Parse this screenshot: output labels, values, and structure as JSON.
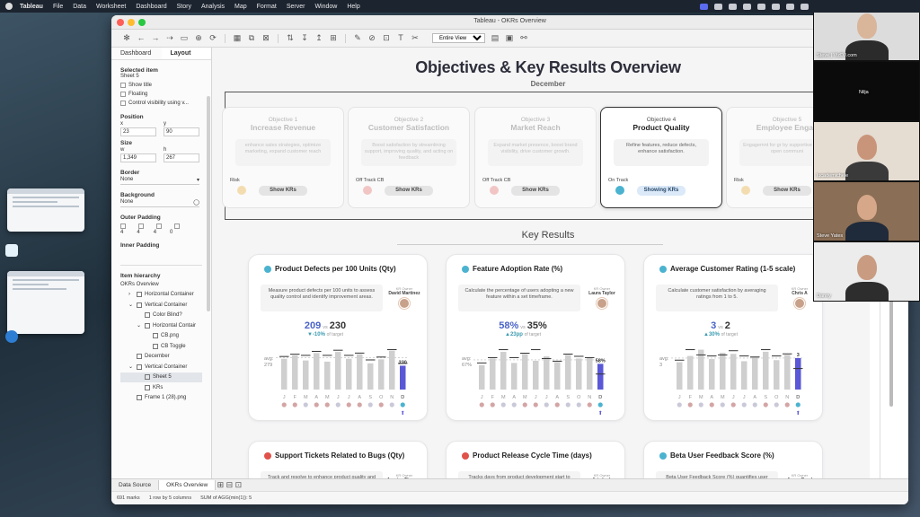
{
  "menubar": {
    "items": [
      "Tableau",
      "File",
      "Data",
      "Worksheet",
      "Dashboard",
      "Story",
      "Analysis",
      "Map",
      "Format",
      "Server",
      "Window",
      "Help"
    ]
  },
  "window": {
    "title": "Tableau - OKRs Overview"
  },
  "toolbar": {
    "fit_select": "Entire View"
  },
  "left_panel": {
    "tabs": [
      "Dashboard",
      "Layout"
    ],
    "selected_label": "Selected item",
    "selected_value": "Sheet 5",
    "show_title": "Show title",
    "floating": "Floating",
    "control_visibility": "Control visibility using v...",
    "position_label": "Position",
    "x_label": "x",
    "y_label": "y",
    "x_value": "23",
    "y_value": "90",
    "size_label": "Size",
    "w_label": "w",
    "h_label": "h",
    "w_value": "1,349",
    "h_value": "267",
    "border_label": "Border",
    "border_value": "None",
    "background_label": "Background",
    "background_value": "None",
    "outer_padding_label": "Outer Padding",
    "outer_padding_values": [
      "4",
      "4",
      "4",
      "0"
    ],
    "inner_padding_label": "Inner Padding",
    "hierarchy_label": "Item hierarchy",
    "hierarchy_root": "OKRs Overview",
    "hierarchy": [
      {
        "label": "Horizontal Container",
        "indent": 1,
        "toggle": ">"
      },
      {
        "label": "Vertical Container",
        "indent": 1,
        "toggle": "v"
      },
      {
        "label": "Color Blind?",
        "indent": 2,
        "toggle": ""
      },
      {
        "label": "Horizontal Contair",
        "indent": 2,
        "toggle": "v"
      },
      {
        "label": "CB.png",
        "indent": 3,
        "toggle": ""
      },
      {
        "label": "CB Toggle",
        "indent": 3,
        "toggle": ""
      },
      {
        "label": "December",
        "indent": 1,
        "toggle": ""
      },
      {
        "label": "Vertical Container",
        "indent": 1,
        "toggle": "v"
      },
      {
        "label": "Sheet 5",
        "indent": 2,
        "toggle": ""
      },
      {
        "label": "KRs",
        "indent": 2,
        "toggle": ""
      },
      {
        "label": "Frame 1 (28).png",
        "indent": 1,
        "toggle": ""
      }
    ]
  },
  "dashboard": {
    "title": "Objectives & Key Results Overview",
    "subtitle": "December",
    "key_results_heading": "Key Results",
    "objectives": [
      {
        "num": "Objective 1",
        "name": "Increase Revenue",
        "desc": "enhance sales strategies, optimize marketing, expand customer reach",
        "status": "Risk",
        "status_color": "#f3ddb0",
        "button": "Show KRs",
        "active": false
      },
      {
        "num": "Objective 2",
        "name": "Customer Satisfaction",
        "desc": "Boost satisfaction by streamlining support, improving quality, and acting on feedback",
        "status": "Off Track CB",
        "status_color": "#f2c5c5",
        "button": "Show KRs",
        "active": false
      },
      {
        "num": "Objective 3",
        "name": "Market Reach",
        "desc": "Expand market presence, boost brand visibility, drive customer growth.",
        "status": "Off Track CB",
        "status_color": "#f2c5c5",
        "button": "Show KRs",
        "active": false
      },
      {
        "num": "Objective 4",
        "name": "Product Quality",
        "desc": "Refine features, reduce defects, enhance satisfaction.",
        "status": "On Track",
        "status_color": "#4bb3cf",
        "button": "Showing KRs",
        "active": true
      },
      {
        "num": "Objective 5",
        "name": "Employee Engag",
        "desc": "Engagemnt for gr by supportive env and open communi",
        "status": "Risk",
        "status_color": "#f3ddb0",
        "button": "Show KRs",
        "active": false
      }
    ],
    "key_results": [
      {
        "title": "Product Defects per 100 Units (Qty)",
        "dot": "#4bb3cf",
        "desc": "Measure product defects per 100 units to assess quality control and identify improvement areas.",
        "owner_label": "KR Owner",
        "owner": "David Martinez",
        "value": "209",
        "target": "230",
        "delta": "▼-10%",
        "delta_label": "of target",
        "avg_label": "avg:",
        "avg": "279",
        "last_label": "230"
      },
      {
        "title": "Feature Adoption Rate (%)",
        "dot": "#4bb3cf",
        "desc": "Calculate the percentage of users adopting a new feature within a set timeframe.",
        "owner_label": "KR Owner",
        "owner": "Laura Taylor",
        "value": "58%",
        "target": "35%",
        "delta": "▲23pp",
        "delta_label": "of target",
        "avg_label": "avg:",
        "avg": "67%",
        "last_label": "58%"
      },
      {
        "title": "Average Customer Rating (1-5 scale)",
        "dot": "#4bb3cf",
        "desc": "Calculate customer satisfaction by averaging ratings from 1 to 5.",
        "owner_label": "KR Owner",
        "owner": "Chris A",
        "value": "3",
        "target": "2",
        "delta": "▲30%",
        "delta_label": "of target",
        "avg_label": "avg:",
        "avg": "3",
        "last_label": "3"
      },
      {
        "title": "Support Tickets Related to Bugs (Qty)",
        "dot": "#e0524a",
        "desc": "Track and resolve to enhance product quality and customer satisfaction.",
        "owner_label": "KR Owner",
        "owner": "Jessica Thomas"
      },
      {
        "title": "Product Release Cycle Time (days)",
        "dot": "#e0524a",
        "desc": "Tracks days from product development start to market release, identifying efficiency. And bottlenecks.",
        "owner_label": "KR Owner",
        "owner": "Aria Lark"
      },
      {
        "title": "Beta User Feedback Score (%)",
        "dot": "#4bb3cf",
        "desc": "Beta User Feedback Score (%) quantifies user satisfaction during beta testing.",
        "owner_label": "KR Owner",
        "owner": "Jason Reed"
      }
    ],
    "months": [
      "J",
      "F",
      "M",
      "A",
      "M",
      "J",
      "J",
      "A",
      "S",
      "O",
      "N",
      "D"
    ],
    "vs": "vs"
  },
  "chart_data": [
    {
      "type": "bar",
      "title": "Product Defects per 100 Units (Qty)",
      "categories": [
        "J",
        "F",
        "M",
        "A",
        "M",
        "J",
        "J",
        "A",
        "S",
        "O",
        "N",
        "D"
      ],
      "values": [
        270,
        300,
        255,
        320,
        245,
        330,
        270,
        310,
        230,
        265,
        340,
        209
      ],
      "targets": [
        290,
        310,
        300,
        335,
        300,
        345,
        300,
        320,
        260,
        285,
        350,
        230
      ],
      "avg": 279,
      "month_dots": [
        "#d4a5a5",
        "#d4a5a5",
        "#c9c9d9",
        "#d4a5a5",
        "#d4a5a5",
        "#c9c9d9",
        "#d4a5a5",
        "#d4a5a5",
        "#c9c9d9",
        "#d4a5a5",
        "#c9c9d9",
        "#4bb3cf"
      ]
    },
    {
      "type": "bar",
      "title": "Feature Adoption Rate (%)",
      "categories": [
        "J",
        "F",
        "M",
        "A",
        "M",
        "J",
        "J",
        "A",
        "S",
        "O",
        "N",
        "D"
      ],
      "values": [
        55,
        70,
        85,
        60,
        80,
        65,
        75,
        62,
        78,
        70,
        72,
        58
      ],
      "targets": [
        60,
        72,
        90,
        72,
        82,
        90,
        70,
        64,
        80,
        75,
        72,
        35
      ],
      "avg": 67,
      "month_dots": [
        "#d4a5a5",
        "#d4a5a5",
        "#c9c9d9",
        "#c9c9d9",
        "#d4a5a5",
        "#d4a5a5",
        "#c9c9d9",
        "#d4a5a5",
        "#c9c9d9",
        "#c9c9d9",
        "#d4a5a5",
        "#4bb3cf"
      ]
    },
    {
      "type": "bar",
      "title": "Average Customer Rating (1-5 scale)",
      "categories": [
        "J",
        "F",
        "M",
        "A",
        "M",
        "J",
        "J",
        "A",
        "S",
        "O",
        "N",
        "D"
      ],
      "values": [
        2.6,
        3.2,
        3.8,
        2.9,
        3.5,
        3.4,
        2.7,
        3.1,
        3.6,
        2.8,
        3.3,
        3
      ],
      "targets": [
        2.8,
        3.8,
        3.3,
        3.2,
        3.3,
        3.7,
        3.2,
        3.1,
        3.8,
        3.2,
        3.4,
        2
      ],
      "avg": 3,
      "month_dots": [
        "#c9c9d9",
        "#d4a5a5",
        "#c9c9d9",
        "#d4a5a5",
        "#c9c9d9",
        "#d4a5a5",
        "#c9c9d9",
        "#c9c9d9",
        "#d4a5a5",
        "#c9c9d9",
        "#d4a5a5",
        "#4bb3cf"
      ]
    }
  ],
  "sheet_tabs": [
    "Data Source",
    "OKRs Overview"
  ],
  "status": {
    "marks": "691 marks",
    "rows": "1 row by 5 columns",
    "sum": "SUM of AGG(min(1)): 5"
  },
  "video_call": [
    {
      "name": "Steve | VizDJ.com",
      "bg": "#dcdcdc",
      "skin": "#d9b59a",
      "shirt": "#2b2b2b"
    },
    {
      "name": "Nilja",
      "bg": "#0b0b0b",
      "skin": "",
      "shirt": ""
    },
    {
      "name": "lucademichele",
      "bg": "#e5dcd2",
      "skin": "#c9957a",
      "shirt": "#3a3a3a"
    },
    {
      "name": "Steve Yates",
      "bg": "#8a6e55",
      "skin": "#d6a788",
      "shirt": "#1f2a3a"
    },
    {
      "name": "Danny",
      "bg": "#ececec",
      "skin": "#c99c82",
      "shirt": "#2d2d2d"
    }
  ],
  "colors": {
    "accent": "#4a63c8",
    "highlight_bar": "#5a58d6",
    "bar": "#cfcfcf",
    "on_track": "#4bb3cf",
    "off_track": "#e0524a"
  }
}
